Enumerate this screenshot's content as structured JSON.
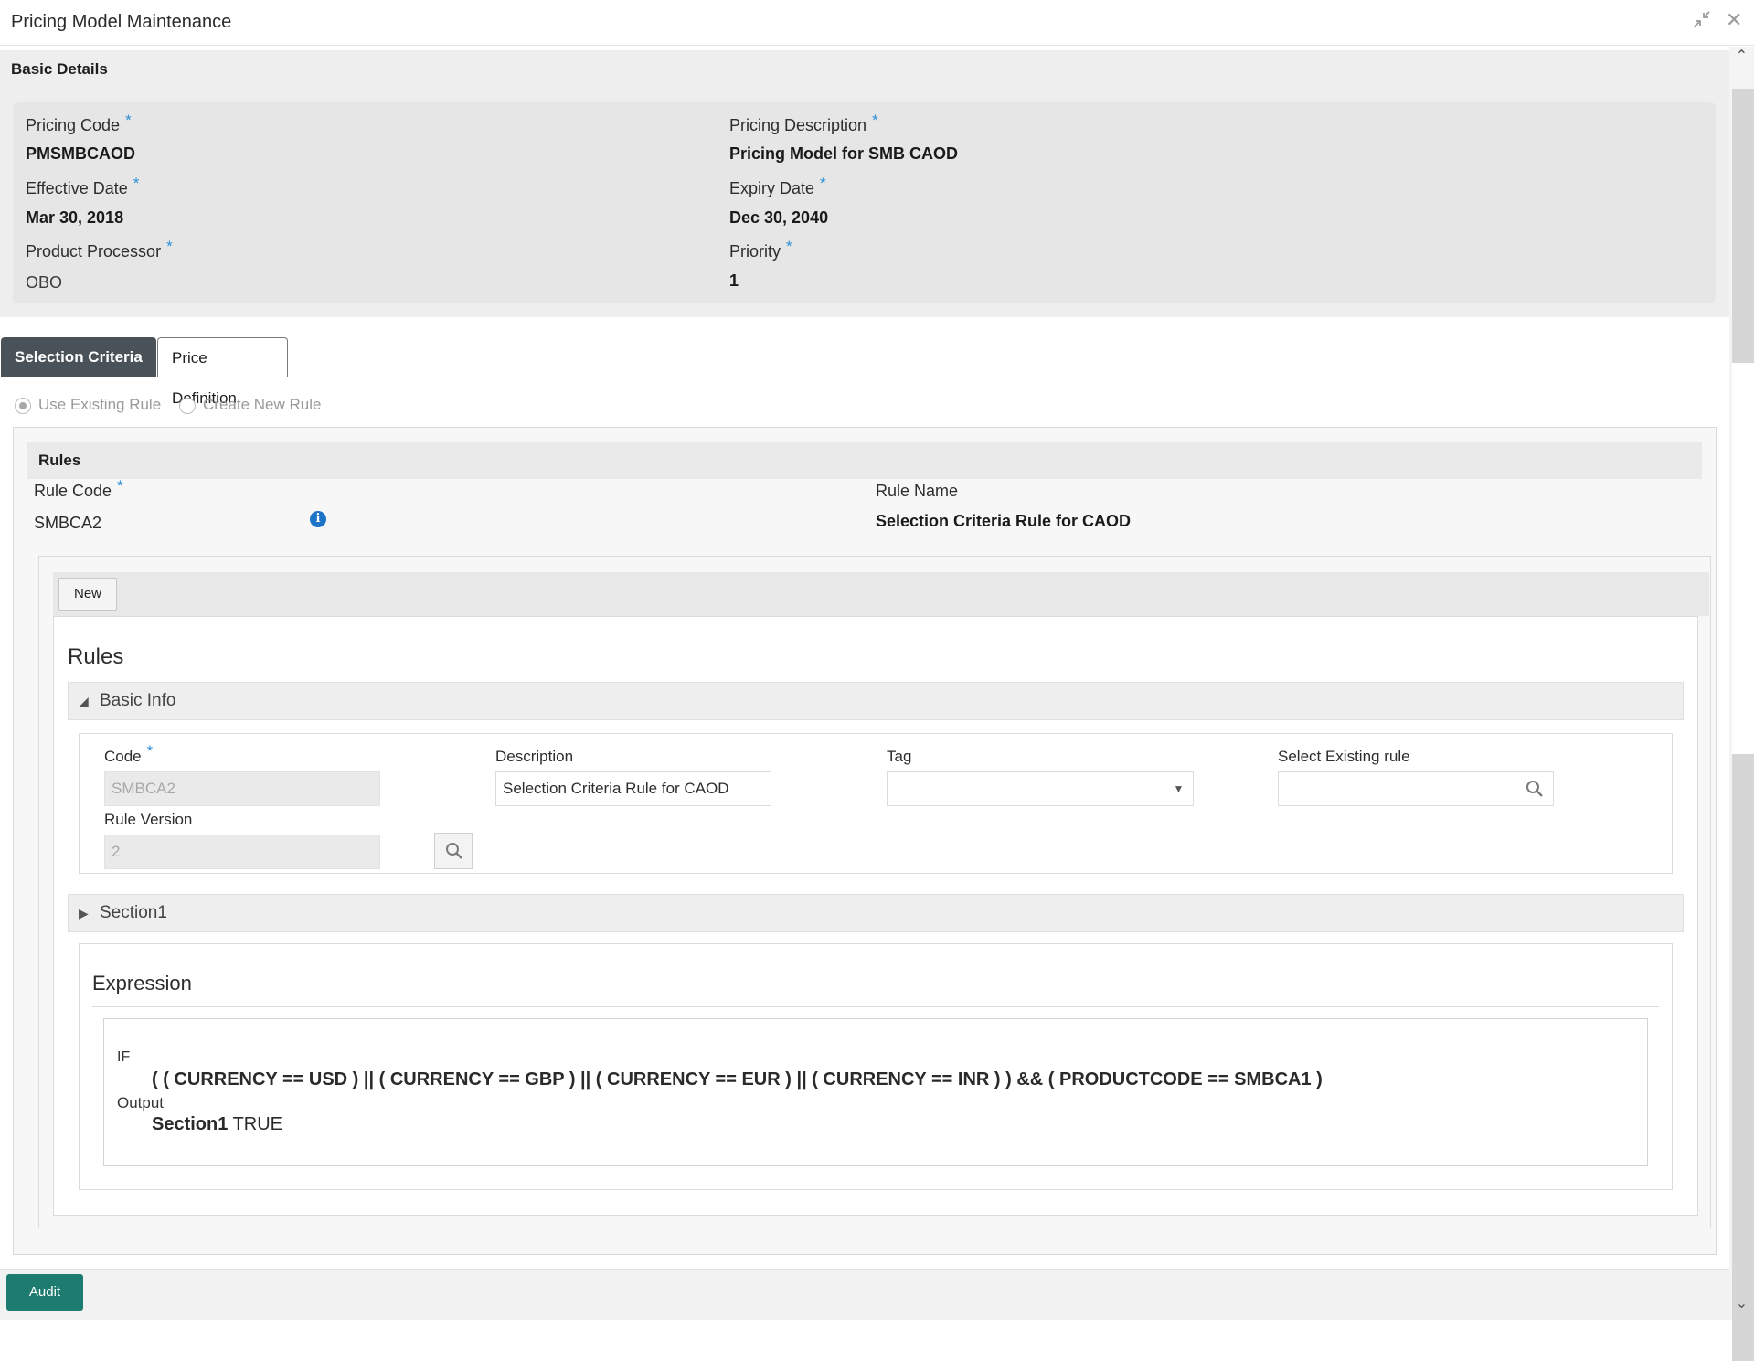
{
  "window": {
    "title": "Pricing Model Maintenance",
    "minimize_icon": "collapse-arrows-icon",
    "close_icon": "close-icon"
  },
  "basic_details": {
    "title": "Basic Details",
    "pricing_code": {
      "label": "Pricing Code",
      "required": "*",
      "value": "PMSMBCAOD"
    },
    "pricing_description": {
      "label": "Pricing Description",
      "required": "*",
      "value": "Pricing Model for SMB CAOD"
    },
    "effective_date": {
      "label": "Effective Date",
      "required": "*",
      "value": "Mar 30, 2018"
    },
    "expiry_date": {
      "label": "Expiry Date",
      "required": "*",
      "value": "Dec 30, 2040"
    },
    "product_processor": {
      "label": "Product Processor",
      "required": "*",
      "value": "OBO"
    },
    "priority": {
      "label": "Priority",
      "required": "*",
      "value": "1"
    }
  },
  "tabs": [
    {
      "label": "Selection Criteria",
      "active": true
    },
    {
      "label": "Price Definition",
      "active": false
    }
  ],
  "rule_mode": {
    "options": [
      {
        "label": "Use Existing Rule",
        "selected": true
      },
      {
        "label": "Create New Rule",
        "selected": false
      }
    ]
  },
  "rules": {
    "title": "Rules",
    "rule_code": {
      "label": "Rule Code",
      "required": "*",
      "value": "SMBCA2"
    },
    "rule_name": {
      "label": "Rule Name",
      "value": "Selection Criteria Rule for CAOD"
    },
    "info_icon": "info-icon"
  },
  "rule_editor": {
    "new_button": "New",
    "heading": "Rules",
    "basic_info": {
      "title": "Basic Info",
      "code": {
        "label": "Code",
        "required": "*",
        "value": "SMBCA2"
      },
      "description": {
        "label": "Description",
        "value": "Selection Criteria Rule for CAOD"
      },
      "tag": {
        "label": "Tag",
        "value": ""
      },
      "select_existing_rule": {
        "label": "Select Existing rule",
        "value": ""
      },
      "rule_version": {
        "label": "Rule Version",
        "value": "2"
      }
    },
    "section1": {
      "title": "Section1"
    },
    "expression": {
      "title": "Expression",
      "if_label": "IF",
      "condition": "( ( CURRENCY == USD ) || ( CURRENCY == GBP ) || ( CURRENCY == EUR ) || ( CURRENCY == INR ) ) && ( PRODUCTCODE == SMBCA1 )",
      "output_label": "Output",
      "output_section": "Section1",
      "output_value": "TRUE"
    }
  },
  "footer": {
    "audit_button": "Audit"
  },
  "colors": {
    "accent": "#1e7b70",
    "active_tab": "#4a5259",
    "required": "#2b8fd6",
    "info": "#1c73c8"
  }
}
